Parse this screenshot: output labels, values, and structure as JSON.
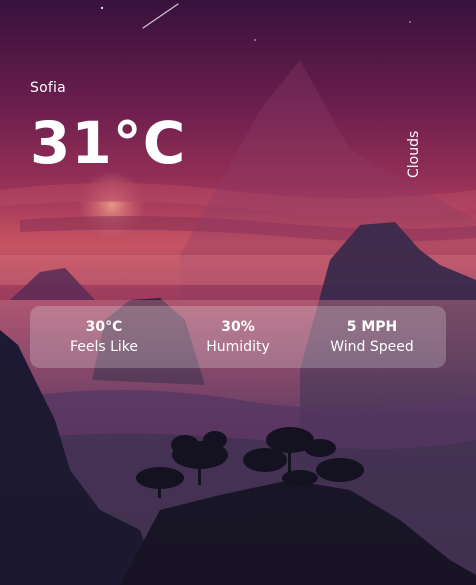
{
  "weather": {
    "city": "Sofia",
    "temperature": "31°C",
    "condition": "Clouds"
  },
  "stats": [
    {
      "value": "30°C",
      "label": "Feels Like"
    },
    {
      "value": "30%",
      "label": "Humidity"
    },
    {
      "value": "5 MPH",
      "label": "Wind Speed"
    }
  ],
  "colors": {
    "sky_top": "#4a1748",
    "sky_mid": "#8a2c56",
    "horizon": "#d2596a",
    "mountain": "#2f203d",
    "panel": "#ffffff",
    "text": "#ffffff"
  }
}
